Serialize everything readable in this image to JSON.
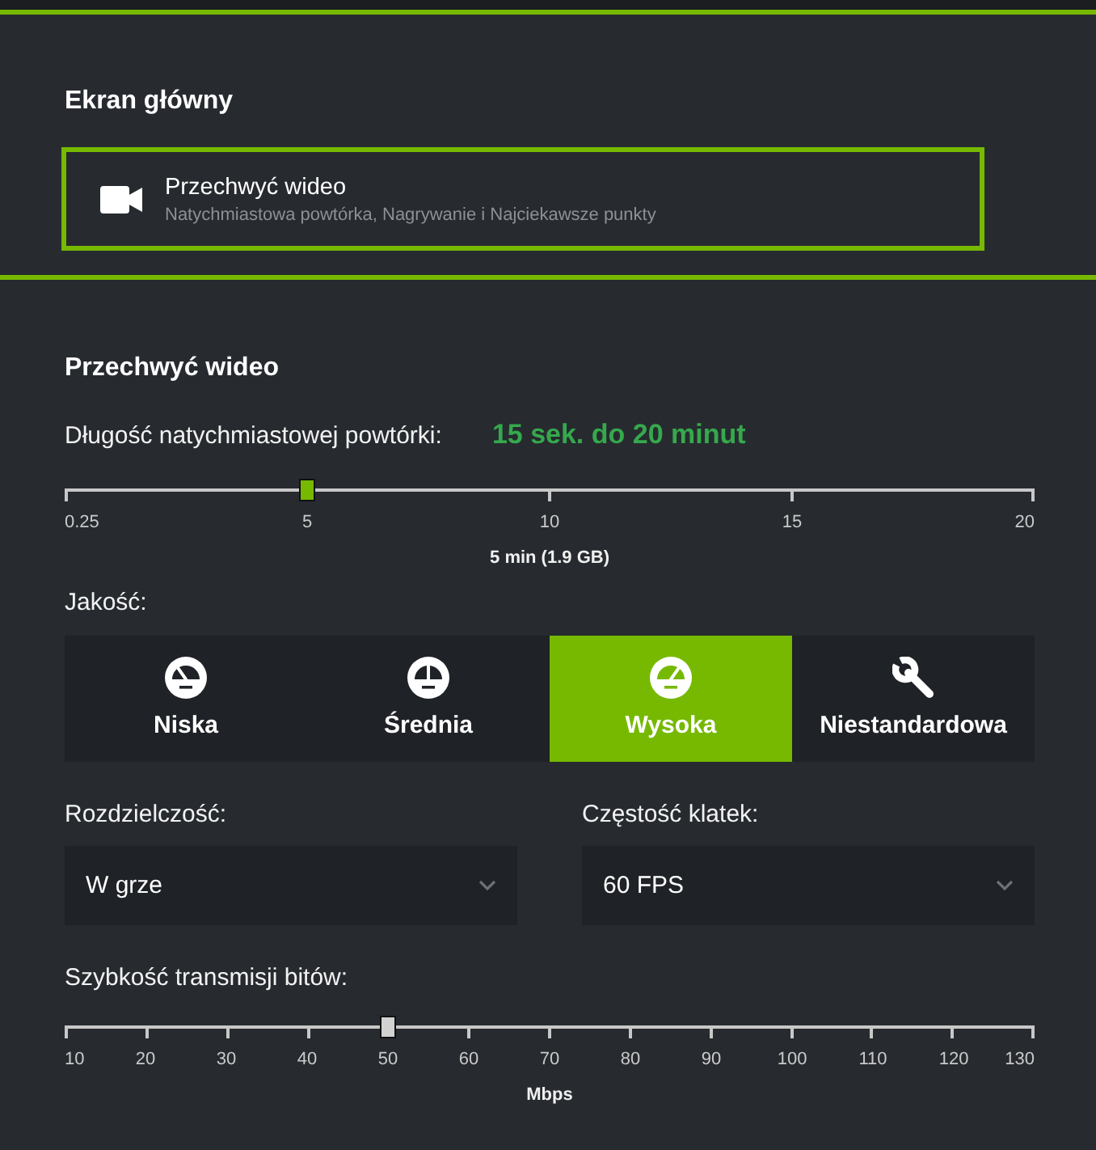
{
  "home": {
    "title": "Ekran główny",
    "card": {
      "title": "Przechwyć wideo",
      "subtitle": "Natychmiastowa powtórka, Nagrywanie i Najciekawsze punkty",
      "highlighted": true
    }
  },
  "capture": {
    "title": "Przechwyć wideo",
    "replay": {
      "label": "Długość natychmiastowej powtórki:",
      "range": "15 sek. do 20 minut",
      "active": true,
      "level": 0.25,
      "ticks": [
        "0.25",
        "5",
        "10",
        "15",
        "20"
      ],
      "reading": "5 min (1.9 GB)"
    },
    "quality": {
      "label": "Jakość:",
      "options": [
        {
          "label": "Niska",
          "kind": "low",
          "selected": false
        },
        {
          "label": "Średnia",
          "kind": "medium",
          "selected": false
        },
        {
          "label": "Wysoka",
          "kind": "high",
          "selected": true
        },
        {
          "label": "Niestandardowa",
          "kind": "custom",
          "selected": false
        }
      ]
    },
    "resolution": {
      "label": "Rozdzielczość:",
      "value": "W grze"
    },
    "frame_rate": {
      "label": "Częstość klatek:",
      "value": "60 FPS"
    },
    "bitrate": {
      "label": "Szybkość transmisji bitów:",
      "active": false,
      "level": 0.3333,
      "ticks": [
        "10",
        "20",
        "30",
        "40",
        "50",
        "60",
        "70",
        "80",
        "90",
        "100",
        "110",
        "120",
        "130"
      ],
      "reading": "Mbps"
    }
  }
}
